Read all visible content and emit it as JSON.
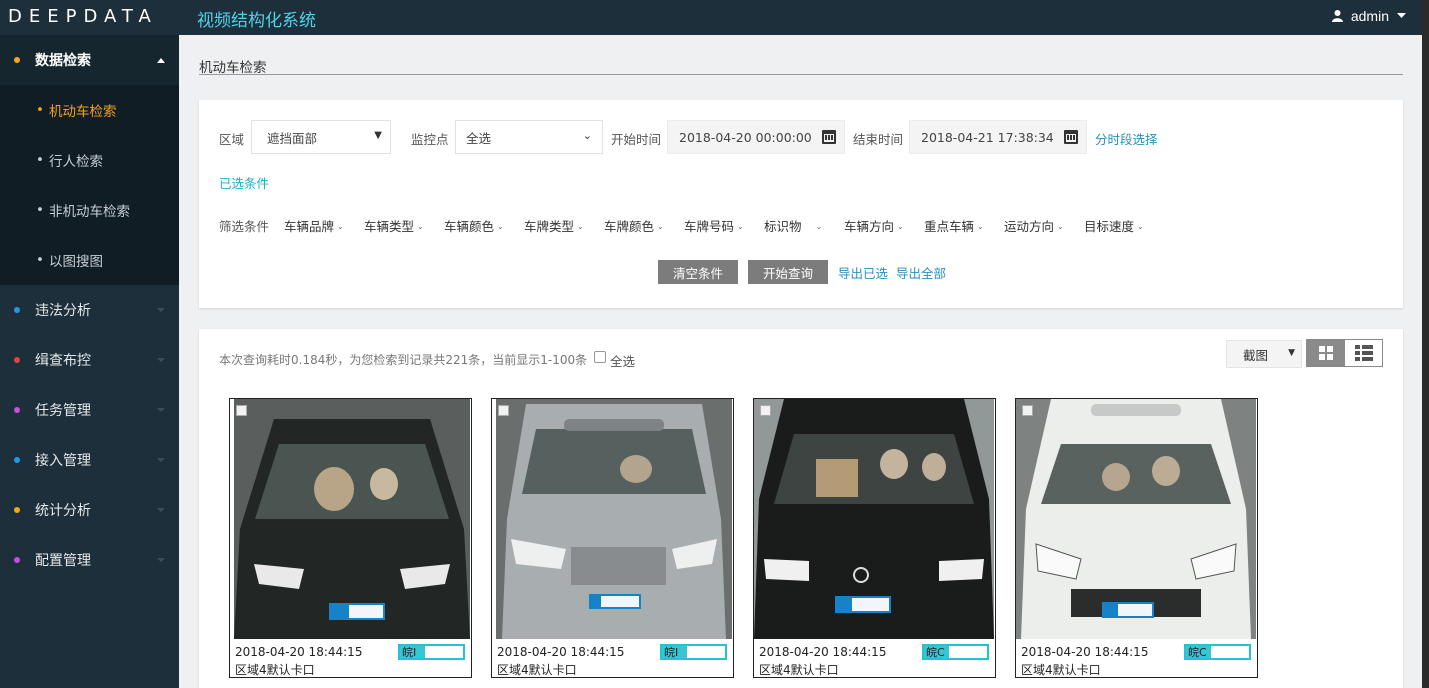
{
  "header": {
    "logo": "DEEPDATA",
    "system_title": "视频结构化系统",
    "user": "admin"
  },
  "sidebar": {
    "items": [
      {
        "label": "数据检索",
        "dot_color": "#f5a623",
        "open": true,
        "children": [
          {
            "label": "机动车检索",
            "active": true
          },
          {
            "label": "行人检索"
          },
          {
            "label": "非机动车检索"
          },
          {
            "label": "以图搜图"
          }
        ]
      },
      {
        "label": "违法分析",
        "dot_color": "#1e9be8"
      },
      {
        "label": "缉查布控",
        "dot_color": "#e5453c"
      },
      {
        "label": "任务管理",
        "dot_color": "#c64ee0"
      },
      {
        "label": "接入管理",
        "dot_color": "#1e9be8"
      },
      {
        "label": "统计分析",
        "dot_color": "#f5a623"
      },
      {
        "label": "配置管理",
        "dot_color": "#c64ee0"
      }
    ]
  },
  "page": {
    "title": "机动车检索"
  },
  "filters": {
    "region_label": "区域",
    "region_value": "遮挡面部",
    "camera_label": "监控点",
    "camera_value": "全选",
    "start_label": "开始时间",
    "start_value": "2018-04-20 00:00:00",
    "end_label": "结束时间",
    "end_value": "2018-04-21 17:38:34",
    "period_link": "分时段选择",
    "selected_conditions": "已选条件",
    "conditions_label": "筛选条件",
    "conditions": [
      "车辆品牌",
      "车辆类型",
      "车辆颜色",
      "车牌类型",
      "车牌颜色",
      "车牌号码",
      "标识物",
      "车辆方向",
      "重点车辆",
      "运动方向",
      "目标速度"
    ],
    "clear_button": "清空条件",
    "search_button": "开始查询",
    "export_selected": "导出已选",
    "export_all": "导出全部"
  },
  "results": {
    "summary": "本次查询耗时0.184秒，为您检索到记录共221条，当前显示1-100条",
    "select_all": "全选",
    "view_mode": "截图",
    "cards": [
      {
        "time": "2018-04-20 18:44:15",
        "plate": "皖I",
        "location": "区域4默认卡口",
        "car_color": "dark"
      },
      {
        "time": "2018-04-20 18:44:15",
        "plate": "皖I",
        "location": "区域4默认卡口",
        "car_color": "silver"
      },
      {
        "time": "2018-04-20 18:44:15",
        "plate": "皖C",
        "location": "区域4默认卡口",
        "car_color": "black"
      },
      {
        "time": "2018-04-20 18:44:15",
        "plate": "皖C",
        "location": "区域4默认卡口",
        "car_color": "white"
      }
    ]
  },
  "colors": {
    "sidebar_bg": "#1d2f3b",
    "accent_orange": "#f4a11c",
    "accent_teal": "#1bb0c7",
    "link_blue": "#2a8fbd"
  }
}
